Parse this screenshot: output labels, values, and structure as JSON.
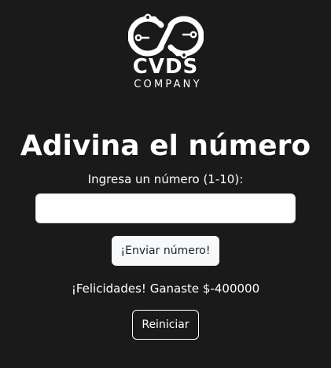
{
  "colors": {
    "background": "#1a1a1a",
    "text": "#ffffff",
    "send_button_bg": "#f8f9fa",
    "send_button_text": "#212529",
    "input_border": "#ced4da"
  },
  "logo": {
    "icon": "infinity-circuit-logo-icon",
    "name": "CVDS",
    "tagline": "COMPANY"
  },
  "game": {
    "title": "Adivina el número",
    "prompt": "Ingresa un número (1-10):",
    "input_value": "",
    "input_placeholder": "",
    "send_label": "¡Enviar número!",
    "message": "¡Felicidades! Ganaste $-400000",
    "reset_label": "Reiniciar"
  }
}
